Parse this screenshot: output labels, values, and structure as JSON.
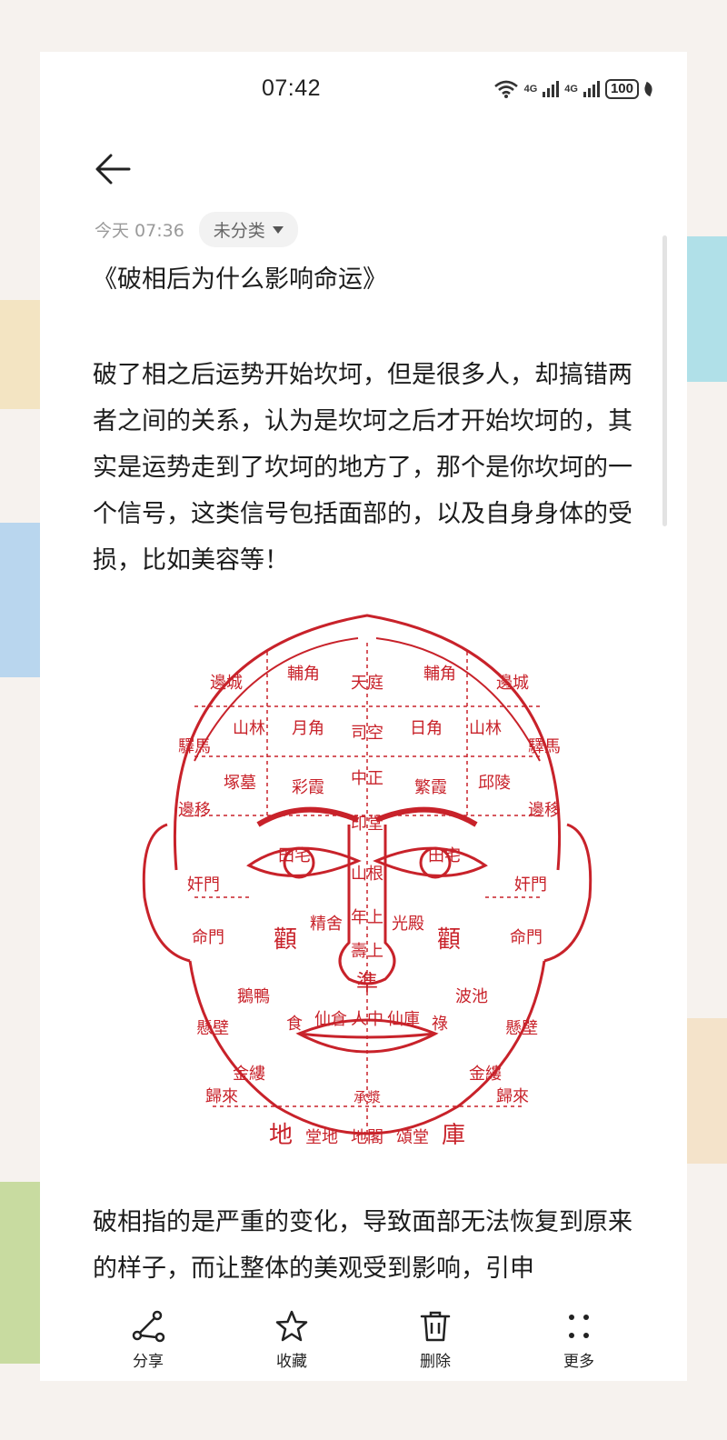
{
  "status_bar": {
    "time": "07:42",
    "signal_1": "4G",
    "signal_2": "4G",
    "battery": "100"
  },
  "note": {
    "timestamp": "今天 07:36",
    "category": "未分类",
    "title": "《破相后为什么影响命运》",
    "paragraph_1": "破了相之后运势开始坎坷，但是很多人，却搞错两者之间的关系，认为是坎坷之后才开始坎坷的，其实是运势走到了坎坷的地方了，那个是你坎坷的一个信号，这类信号包括面部的，以及自身身体的受损，比如美容等！",
    "paragraph_2": "破相指的是严重的变化，导致面部无法恢复到原来的样子，而让整体的美观受到影响，引申"
  },
  "face_chart": {
    "labels": {
      "fujiao_l": "輔角",
      "tianting": "天庭",
      "fujiao_r": "輔角",
      "biancheng_l": "邊城",
      "biancheng_r": "邊城",
      "shanlin_l": "山林",
      "yuejiao": "月角",
      "sikong": "司空",
      "rijiao": "日角",
      "shanlin_r": "山林",
      "yima_l": "驛馬",
      "yima_r": "驛馬",
      "zhongmu": "塚墓",
      "caixia": "彩霞",
      "zhongzheng": "中正",
      "fanxia": "繁霞",
      "qiuling": "邱陵",
      "bianyi_l": "邊移",
      "bianyi_r": "邊移",
      "yintang": "印堂",
      "tianzhai_l": "田宅",
      "tianzhai_r": "田宅",
      "jianmen_l": "奸門",
      "shangen": "山根",
      "jianmen_r": "奸門",
      "mingmen_l": "命門",
      "jingshe": "精舍",
      "nianshang": "年上",
      "guangdian": "光殿",
      "mingmen_r": "命門",
      "quan_l": "顴",
      "quan_r": "顴",
      "shoushang": "壽上",
      "zhun": "準",
      "eya": "鵝鴨",
      "bochi": "波池",
      "xuanbi_l": "懸壁",
      "xuanbi_r": "懸壁",
      "shi": "食",
      "xiancang_l": "仙倉",
      "renzhong": "人中",
      "xianku": "仙庫",
      "lu": "祿",
      "jinlou_l": "金縷",
      "jinlou_r": "金縷",
      "guilai_l": "歸來",
      "guilai_r": "歸來",
      "chengjiang": "承漿",
      "di": "地",
      "tangdi": "堂地",
      "dige": "地閣",
      "songtang": "頌堂",
      "ku": "庫"
    }
  },
  "actions": {
    "share": "分享",
    "favorite": "收藏",
    "delete": "删除",
    "more": "更多"
  },
  "colors": {
    "chart_red": "#c8222a",
    "text": "#1c1c1c",
    "meta": "#9a9a9a"
  }
}
